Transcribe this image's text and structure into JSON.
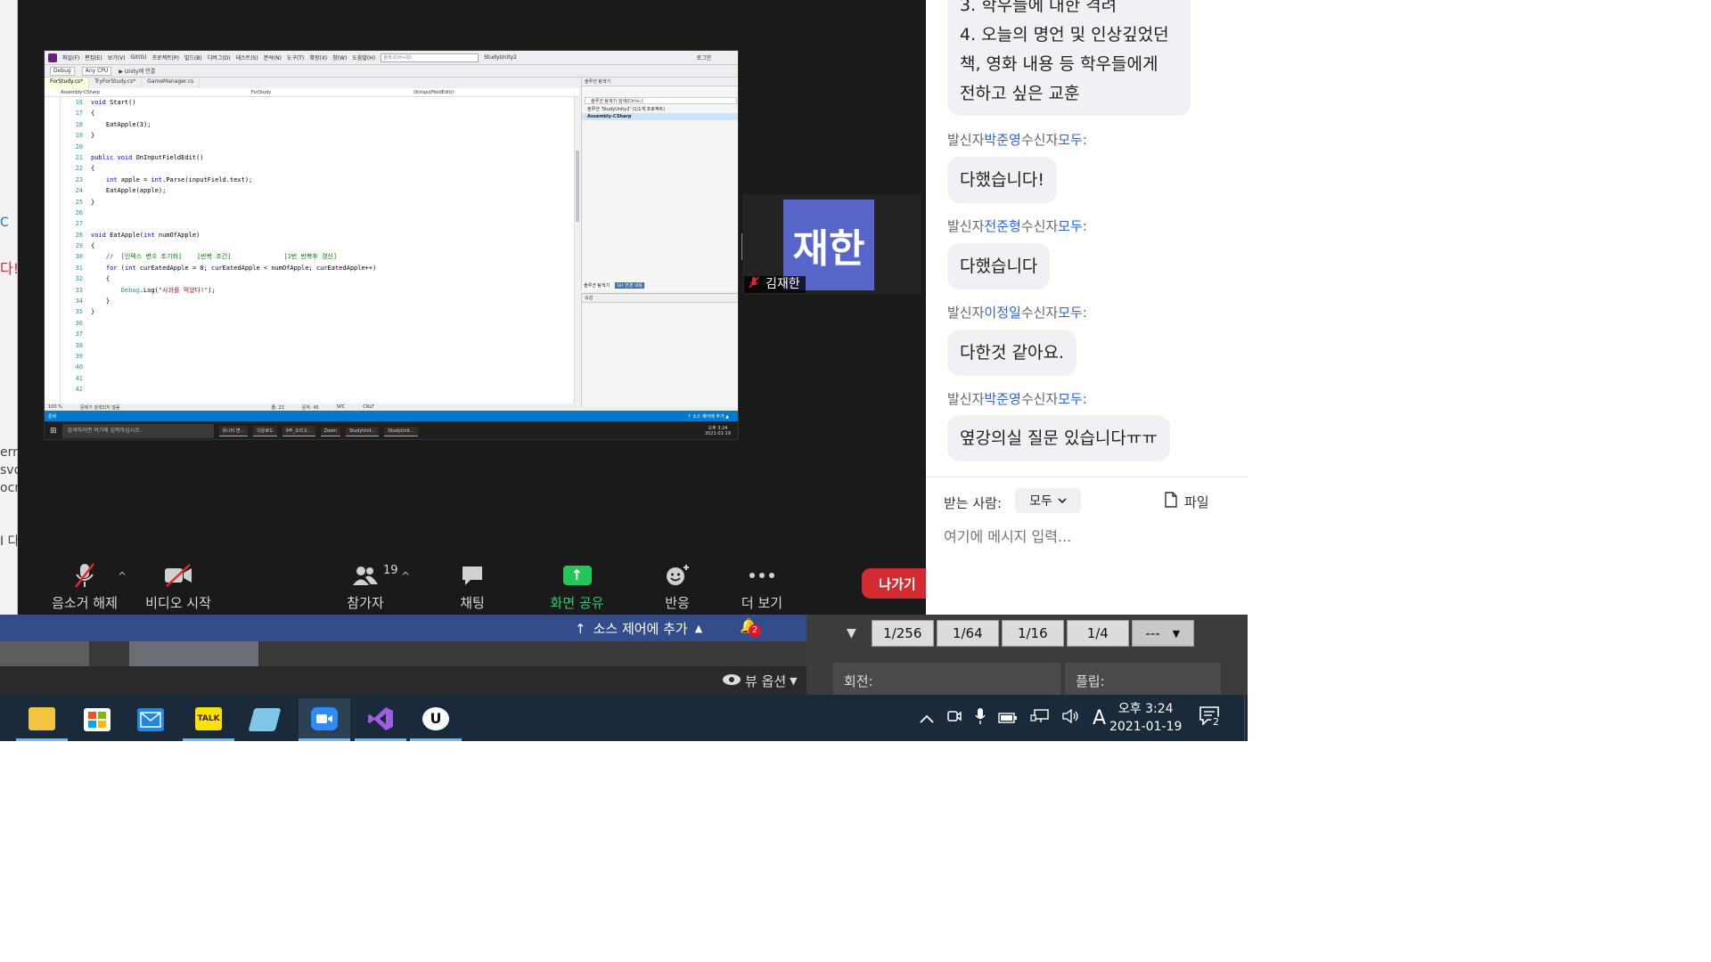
{
  "background_left": {
    "fragments": [
      "C",
      "다!",
      "ern",
      "svo",
      "ocr",
      "I 다"
    ]
  },
  "shared_screen": {
    "vs": {
      "menu_items": [
        "파일(F)",
        "편집(E)",
        "보기(V)",
        "Git(G)",
        "프로젝트(P)",
        "빌드(B)",
        "디버그(D)",
        "테스트(S)",
        "분석(N)",
        "도구(T)",
        "확장(X)",
        "창(W)",
        "도움말(H)"
      ],
      "search_placeholder": "검색 (Ctrl+Q)",
      "window_title": "StudyUnity2",
      "account": "로그인",
      "toolbar": {
        "config": "Debug",
        "platform": "Any CPU",
        "attach": "▶ Unity에 연결"
      },
      "tabs": [
        "ForStudy.cs*",
        "TryForStudy.cs*",
        "GameManager.cs"
      ],
      "nav": {
        "project": "Assembly-CSharp",
        "class": "ForStudy",
        "member": "OnInputFieldEdit()"
      },
      "line_numbers": [
        "16",
        "17",
        "18",
        "19",
        "20",
        "21",
        "22",
        "23",
        "24",
        "25",
        "26",
        "27",
        "28",
        "29",
        "30",
        "31",
        "32",
        "33",
        "34",
        "35",
        "36",
        "37",
        "38",
        "39",
        "40",
        "41",
        "42"
      ],
      "editor_status": {
        "zoom": "100 %",
        "issues": "문제가 검색되지 않음",
        "line": "줄: 23",
        "col": "문자: 45",
        "spc": "SPC",
        "crlf": "CRLF"
      },
      "solution_explorer": {
        "title": "솔루션 탐색기",
        "search": "솔루션 탐색기 검색(Ctrl+;)",
        "solution": "솔루션 'StudyUnity2' (1/1개 프로젝트)",
        "project": "Assembly-CSharp",
        "tabs": [
          "솔루션 탐색기",
          "Git 변경 내용"
        ]
      },
      "properties_title": "속성",
      "status": {
        "ready": "준비",
        "source_control": "↑ 소스 제어에 추가 ▲"
      }
    },
    "mini_taskbar": {
      "search": "검색하려면 여기에 입력하십시오.",
      "apps": [
        "유니티 변...",
        "다운로드",
        "9주_오리고...",
        "Zoom",
        "StudyUnit...",
        "StudyUnit..."
      ],
      "time": "오후 3:24",
      "date": "2021-01-19"
    }
  },
  "participant": {
    "avatar_text": "재한",
    "name": "김재한"
  },
  "controls": {
    "mute": "음소거 해제",
    "video": "비디오 시작",
    "participants": "참가자",
    "participants_count": "19",
    "chat": "채팅",
    "share": "화면 공유",
    "reactions": "반응",
    "more": "더 보기",
    "leave": "나가기"
  },
  "chat": {
    "top_partial": [
      "3. 학우들에 대한 격려",
      "4. 오늘의 명언 및 인상깊었던",
      "책, 영화 내용 등 학우들에게",
      "전하고 싶은 교훈"
    ],
    "labels": {
      "from": "발신자",
      "to": "수신자"
    },
    "messages": [
      {
        "sender": "박준영",
        "recipient": "모두",
        "text": "다했습니다!"
      },
      {
        "sender": "전준형",
        "recipient": "모두",
        "text": "다했습니다"
      },
      {
        "sender": "이정일",
        "recipient": "모두",
        "text": "다한것 같아요."
      },
      {
        "sender": "박준영",
        "recipient": "모두",
        "text": "옆강의실 질문 있습니다ㅠㅠ"
      }
    ],
    "receiver_label": "받는 사람:",
    "receiver_value": "모두",
    "file_label": "파일",
    "input_placeholder": "여기에 메시지 입력..."
  },
  "lower_bar": {
    "source_control": "소스 제어에 추가",
    "notifications": "2",
    "view_options": "뷰 옵션"
  },
  "scale_panel": {
    "buttons": [
      "1/256",
      "1/64",
      "1/16",
      "1/4"
    ],
    "dropdown": "---",
    "rotation_label": "회전:",
    "flip_label": "플립:"
  },
  "taskbar": {
    "time": "오후 3:24",
    "date": "2021-01-19",
    "ime": "A",
    "notification_count": "2",
    "talk_label": "TALK"
  }
}
